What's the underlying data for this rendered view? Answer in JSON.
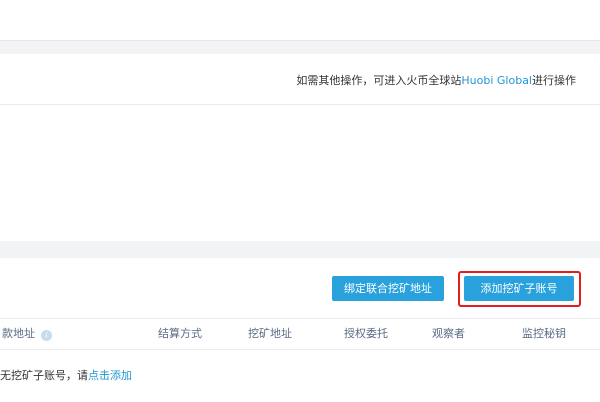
{
  "top_notice": {
    "prefix": "如需其他操作，可进入火币全球站",
    "link": "Huobi Global",
    "suffix": "进行操作"
  },
  "actions": {
    "bind_joint_label": "绑定联合挖矿地址",
    "add_account_label": "添加挖矿子账号"
  },
  "table": {
    "columns": [
      "款地址",
      "结算方式",
      "挖矿地址",
      "授权委托",
      "观察者",
      "监控秘钥"
    ],
    "info_icon_glyph": "i",
    "empty_text": "无挖矿子账号，请",
    "empty_link": "点击添加"
  },
  "colors": {
    "accent": "#29a1dc",
    "link": "#1f96d6",
    "highlight_border": "#e02020"
  },
  "icons": {
    "info": "info-icon"
  }
}
